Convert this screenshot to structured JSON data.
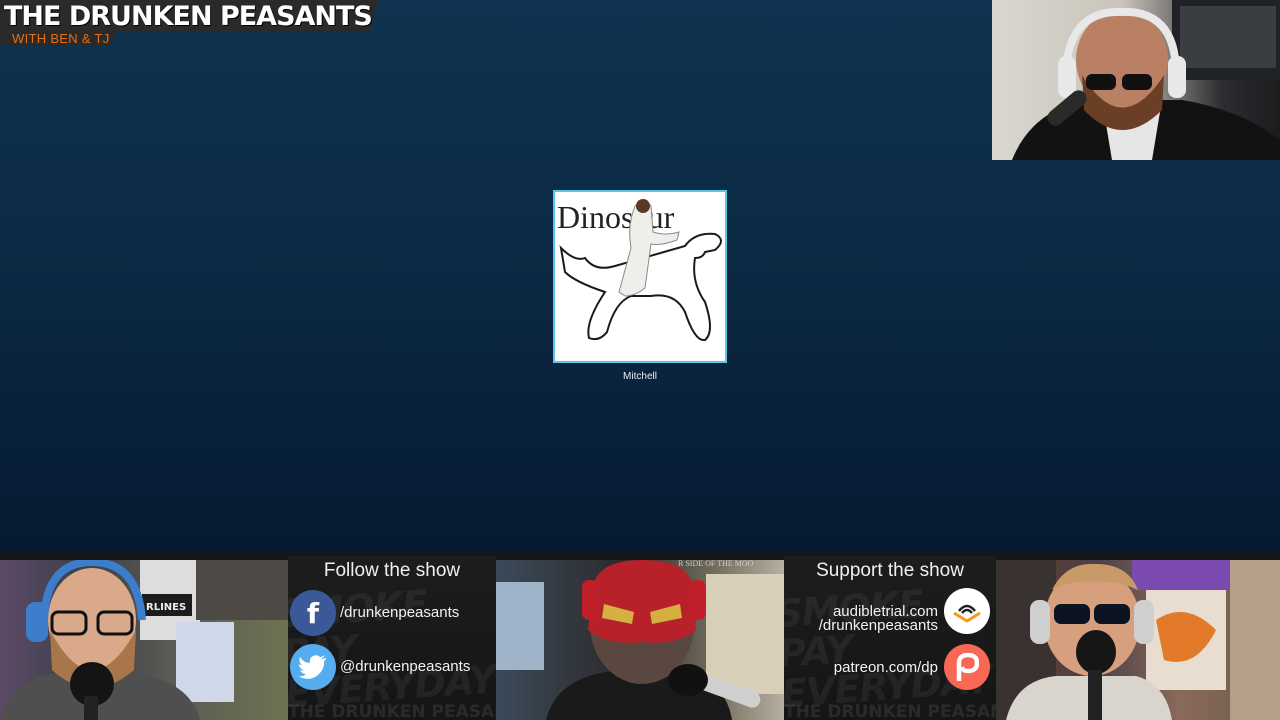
{
  "show": {
    "title": "THE DRUNKEN PEASANTS",
    "subtitle": "WITH BEN & TJ"
  },
  "call": {
    "participant_name": "Mitchell",
    "participant_avatar_text": "Dinosaur"
  },
  "follow_panel": {
    "heading": "Follow the show",
    "facebook": "/drunkenpeasants",
    "twitter": "@drunkenpeasants",
    "watermark": "SMOKE PAY EVERYDAY",
    "footer": "THE DRUNKEN PEASANTS"
  },
  "support_panel": {
    "heading": "Support the show",
    "audible_line1": "audibletrial.com",
    "audible_line2": "/drunkenpeasants",
    "patreon": "patreon.com/dp",
    "watermark": "SMOKE PAY EVERYDAY",
    "footer": "THE DRUNKEN PEASANTS"
  },
  "webcams": {
    "left_poster_text": "RLINES",
    "mid_poster_text": "R SIDE OF THE MOO"
  },
  "colors": {
    "accent_border": "#5bc7e6",
    "logo_subtitle": "#e0701a",
    "facebook": "#3b5998",
    "twitter": "#55acee",
    "patreon": "#f96854"
  }
}
